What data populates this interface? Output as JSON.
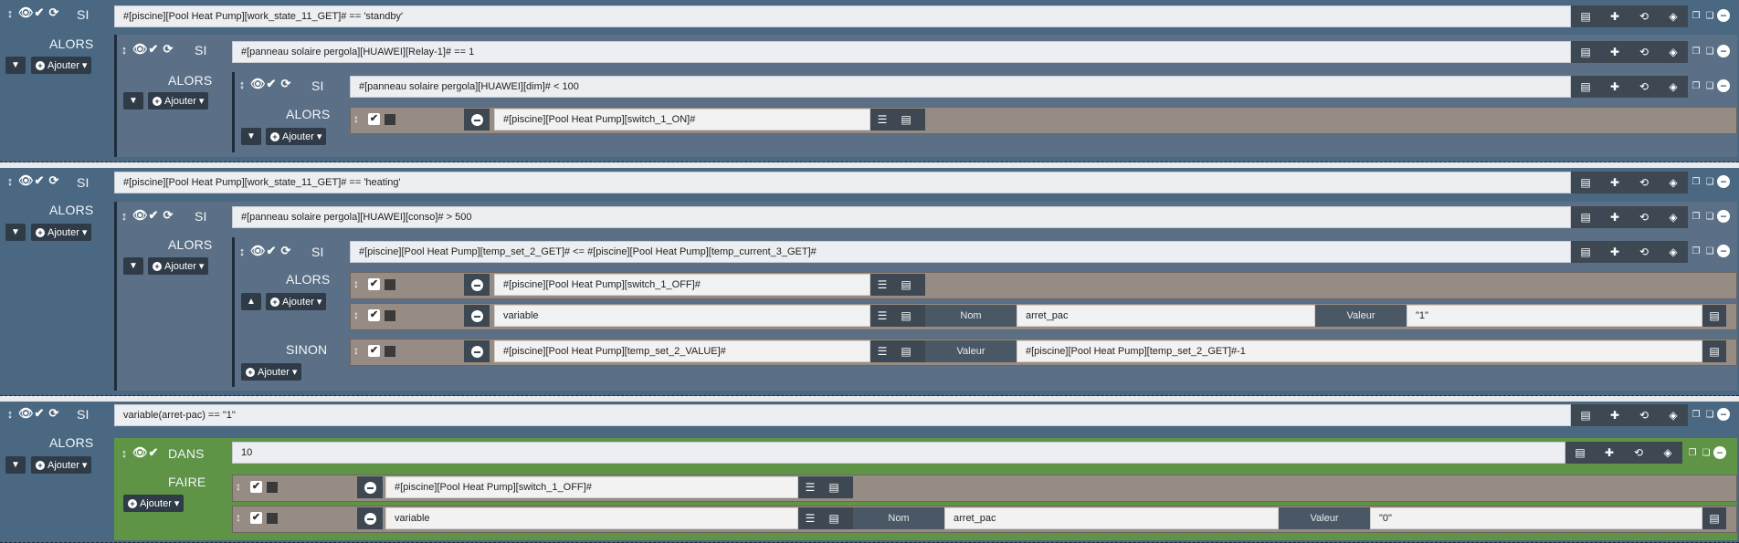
{
  "labels": {
    "si": "SI",
    "alors": "ALORS",
    "sinon": "SINON",
    "dans": "DANS",
    "faire": "FAIRE",
    "ajouter": "Ajouter",
    "nom": "Nom",
    "valeur": "Valeur"
  },
  "icons": {
    "move": "move-icon",
    "eye": "eye-icon",
    "check": "check-icon",
    "refresh": "refresh-icon",
    "list": "list-icon",
    "puzzle": "puzzle-icon",
    "history": "history-icon",
    "cube": "cube-icon",
    "copy": "copy-icon",
    "paste": "paste-icon",
    "remove": "minus-circle-icon"
  },
  "colors": {
    "block": "#4b6882",
    "sub": "#5b7086",
    "action": "#978c84",
    "dans": "#5f9446",
    "dark": "#3d4853"
  },
  "block1": {
    "condition": "#[piscine][Pool Heat Pump][work_state_11_GET]# == 'standby'",
    "sub": {
      "condition": "#[panneau solaire pergola][HUAWEI][Relay-1]# == 1",
      "sub": {
        "condition": "#[panneau solaire pergola][HUAWEI][dim]# < 100",
        "action1": "#[piscine][Pool Heat Pump][switch_1_ON]#"
      }
    }
  },
  "block2": {
    "condition": "#[piscine][Pool Heat Pump][work_state_11_GET]# == 'heating'",
    "sub": {
      "condition": "#[panneau solaire pergola][HUAWEI][conso]# > 500",
      "sub": {
        "condition": "#[piscine][Pool Heat Pump][temp_set_2_GET]# <= #[piscine][Pool Heat Pump][temp_current_3_GET]#",
        "action1": "#[piscine][Pool Heat Pump][switch_1_OFF]#",
        "action2": "variable",
        "action2_nom": "arret_pac",
        "action2_valeur": "\"1\"",
        "sinon_action": "#[piscine][Pool Heat Pump][temp_set_2_VALUE]#",
        "sinon_valeur": "#[piscine][Pool Heat Pump][temp_set_2_GET]#-1"
      }
    }
  },
  "block3": {
    "condition": "variable(arret-pac) == \"1\"",
    "dans_value": "10",
    "action1": "#[piscine][Pool Heat Pump][switch_1_OFF]#",
    "action2": "variable",
    "action2_nom": "arret_pac",
    "action2_valeur": "\"0\""
  }
}
